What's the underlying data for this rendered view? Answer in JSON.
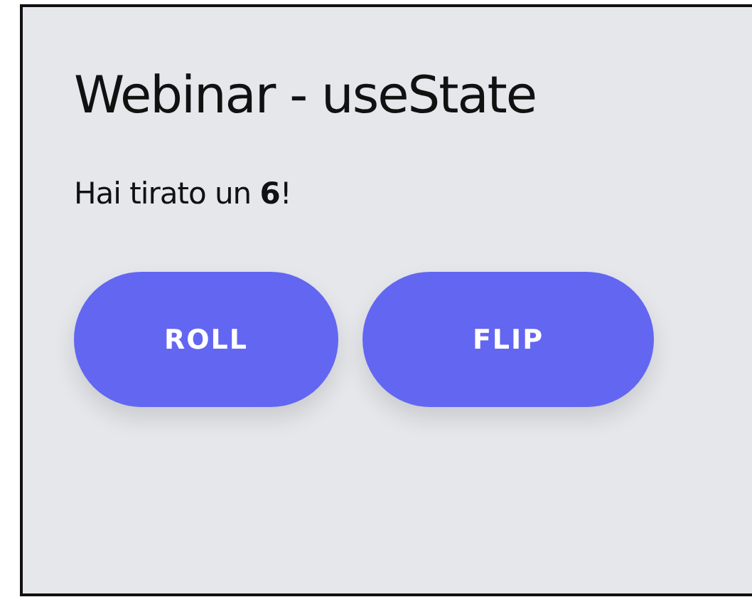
{
  "title": "Webinar - useState",
  "message": "Hai tirato un **6**!",
  "buttons": [
    {
      "label": "ROLL"
    },
    {
      "label": "FLIP"
    }
  ]
}
